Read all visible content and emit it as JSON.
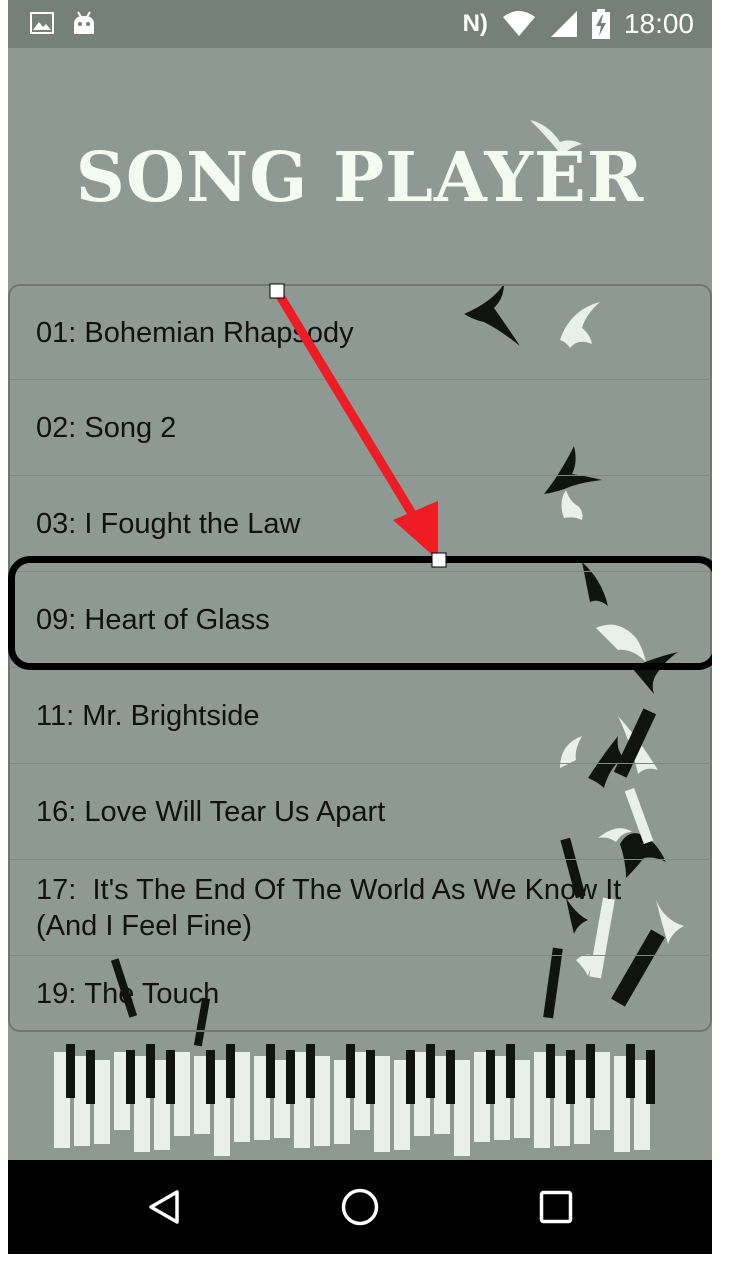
{
  "status_bar": {
    "time": "18:00",
    "nfc_label": "N)",
    "icons": [
      "image-icon",
      "android-icon",
      "nfc-icon",
      "wifi-icon",
      "cell-signal-icon",
      "battery-charging-icon"
    ]
  },
  "app": {
    "title": "SONG PLAYER",
    "songs": [
      {
        "number": "01:",
        "title": "Bohemian Rhapsody"
      },
      {
        "number": "02:",
        "title": "Song 2"
      },
      {
        "number": "03:",
        "title": "I Fought the Law"
      },
      {
        "number": "09:",
        "title": "Heart of Glass"
      },
      {
        "number": "11:",
        "title": "Mr. Brightside"
      },
      {
        "number": "16:",
        "title": "Love Will Tear Us Apart"
      },
      {
        "number": "17:",
        "title": "It's The End Of The World As We Know It (And I Feel Fine)"
      },
      {
        "number": "19:",
        "title": "The Touch"
      }
    ]
  },
  "annotation": {
    "arrow_color": "#ee1c24",
    "highlight_color": "#000000",
    "highlighted_song_index": 3
  },
  "navigation": {
    "icons": [
      "back-icon",
      "home-icon",
      "recents-icon"
    ]
  }
}
